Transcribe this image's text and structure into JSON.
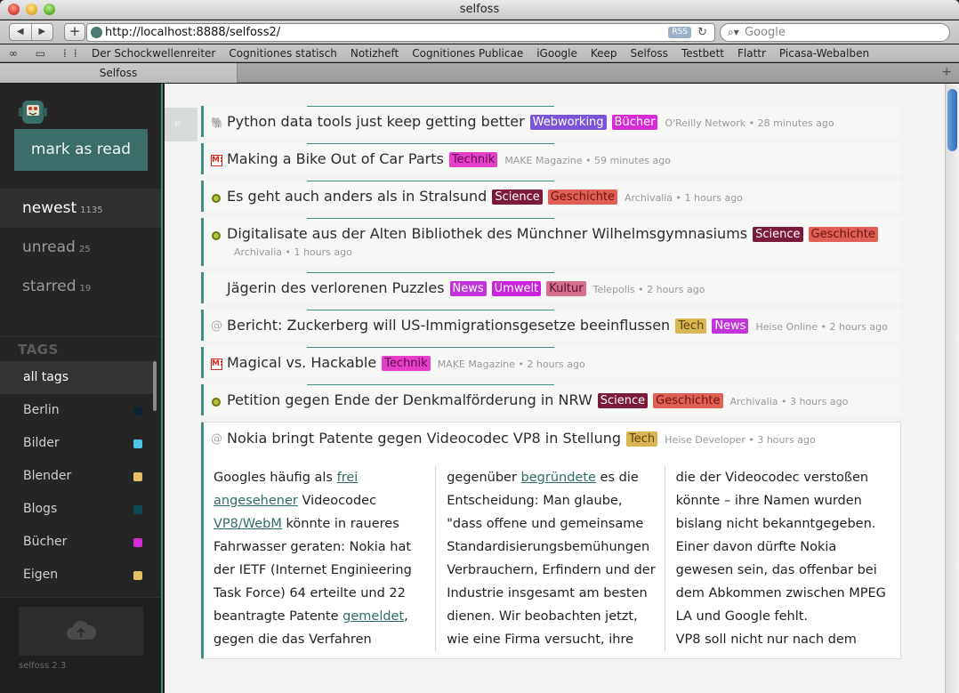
{
  "window": {
    "title": "selfoss"
  },
  "toolbar": {
    "url": "http://localhost:8888/selfoss2/",
    "rss_label": "RSS",
    "search_placeholder": "Google"
  },
  "bookmarks": [
    "Der Schockwellenreiter",
    "Cognitiones statisch",
    "Notizheft",
    "Cognitiones Publicae",
    "iGoogle",
    "Keep",
    "Selfoss",
    "Testbett",
    "Flattr",
    "Picasa-Webalben"
  ],
  "tab": {
    "label": "Selfoss"
  },
  "sidebar": {
    "mark_as_read": "mark as read",
    "filters": [
      {
        "label": "newest",
        "count": "1135"
      },
      {
        "label": "unread",
        "count": "25"
      },
      {
        "label": "starred",
        "count": "19"
      }
    ],
    "tags_heading": "TAGS",
    "tags": [
      {
        "label": "all tags",
        "color": ""
      },
      {
        "label": "Berlin",
        "color": "#0d2533"
      },
      {
        "label": "Bilder",
        "color": "#4fc6e3"
      },
      {
        "label": "Blender",
        "color": "#e8c064"
      },
      {
        "label": "Blogs",
        "color": "#0b4a55"
      },
      {
        "label": "Bücher",
        "color": "#d62ad6"
      },
      {
        "label": "Eigen",
        "color": "#e8c064"
      }
    ],
    "version": "selfoss 2.3"
  },
  "entries": [
    {
      "icon": "oreilly-icon",
      "title": "Python data tools just keep getting better",
      "tags": [
        {
          "label": "Webworking",
          "bg": "#7a55d9",
          "fg": "#ffffff"
        },
        {
          "label": "Bücher",
          "bg": "#d62ad6",
          "fg": "#ffffff"
        }
      ],
      "source": "O'Reilly Network",
      "time": "28 minutes ago"
    },
    {
      "icon": "make-icon",
      "title": "Making a Bike Out of Car Parts",
      "tags": [
        {
          "label": "Technik",
          "bg": "#e63fcb",
          "fg": "#5a0b4a"
        }
      ],
      "source": "MAKE Magazine",
      "time": "59 minutes ago"
    },
    {
      "icon": "archivalia-icon",
      "title": "Es geht auch anders als in Stralsund",
      "tags": [
        {
          "label": "Science",
          "bg": "#7b1a3a",
          "fg": "#ffffff"
        },
        {
          "label": "Geschichte",
          "bg": "#e06055",
          "fg": "#6a1510"
        }
      ],
      "source": "Archivalia",
      "time": "1 hours ago"
    },
    {
      "icon": "archivalia-icon",
      "title": "Digitalisate aus der Alten Bibliothek des Münchner Wilhelmsgymnasiums",
      "tags": [
        {
          "label": "Science",
          "bg": "#7b1a3a",
          "fg": "#ffffff"
        },
        {
          "label": "Geschichte",
          "bg": "#e06055",
          "fg": "#6a1510"
        }
      ],
      "source": "Archivalia",
      "time": "1 hours ago"
    },
    {
      "icon": "",
      "title": "Jägerin des verlorenen Puzzles",
      "tags": [
        {
          "label": "News",
          "bg": "#c234db",
          "fg": "#ffffff"
        },
        {
          "label": "Umwelt",
          "bg": "#cc22dd",
          "fg": "#ffffff"
        },
        {
          "label": "Kultur",
          "bg": "#d5708f",
          "fg": "#5a1030"
        }
      ],
      "source": "Telepolis",
      "time": "2 hours ago"
    },
    {
      "icon": "heise-icon",
      "title": "Bericht: Zuckerberg will US-Immigrationsgesetze beeinflussen",
      "tags": [
        {
          "label": "Tech",
          "bg": "#d9b654",
          "fg": "#5a4510"
        },
        {
          "label": "News",
          "bg": "#c234db",
          "fg": "#ffffff"
        }
      ],
      "source": "Heise Online",
      "time": "2 hours ago"
    },
    {
      "icon": "make-icon",
      "title": "Magical vs. Hackable",
      "tags": [
        {
          "label": "Technik",
          "bg": "#e63fcb",
          "fg": "#5a0b4a"
        }
      ],
      "source": "MAKE Magazine",
      "time": "2 hours ago"
    },
    {
      "icon": "archivalia-icon",
      "title": "Petition gegen Ende der Denkmalförderung in NRW",
      "tags": [
        {
          "label": "Science",
          "bg": "#7b1a3a",
          "fg": "#ffffff"
        },
        {
          "label": "Geschichte",
          "bg": "#e06055",
          "fg": "#6a1510"
        }
      ],
      "source": "Archivalia",
      "time": "3 hours ago"
    }
  ],
  "open_entry": {
    "title": "Nokia bringt Patente gegen Videocodec VP8 in Stellung",
    "tag": {
      "label": "Tech",
      "bg": "#d9b654",
      "fg": "#5a4510"
    },
    "source": "Heise Developer",
    "time": "3 hours ago",
    "col1": [
      {
        "t": "Googles häufig als "
      },
      {
        "t": "frei angesehener",
        "link": true
      },
      {
        "t": " Videocodec "
      },
      {
        "t": "VP8/WebM",
        "link": true
      },
      {
        "t": " könnte in raueres Fahrwasser geraten: Nokia hat der IETF (Internet Enginieering Task Force) 64 erteilte und 22 beantragte Patente "
      },
      {
        "t": "gemeldet",
        "link": true
      },
      {
        "t": ", gegen die das Verfahren"
      }
    ],
    "col2": [
      {
        "t": "gegenüber "
      },
      {
        "t": "begründete",
        "link": true
      },
      {
        "t": " es die Entscheidung: Man glaube, \"dass offene und gemeinsame Standardisierungsbemühungen Verbrauchern, Erfindern und der Industrie insgesamt am besten dienen. Wir beobachten jetzt, wie eine Firma versucht, ihre"
      }
    ],
    "col3": [
      {
        "t": "die der Videocodec verstoßen könnte – ihre Namen wurden bislang nicht bekanntgegeben. Einer davon dürfte Nokia gewesen sein, das offenbar bei dem Abkommen zwischen MPEG LA und Google fehlt."
      },
      {
        "t": "\nVP8 soll nicht nur nach dem"
      }
    ]
  }
}
